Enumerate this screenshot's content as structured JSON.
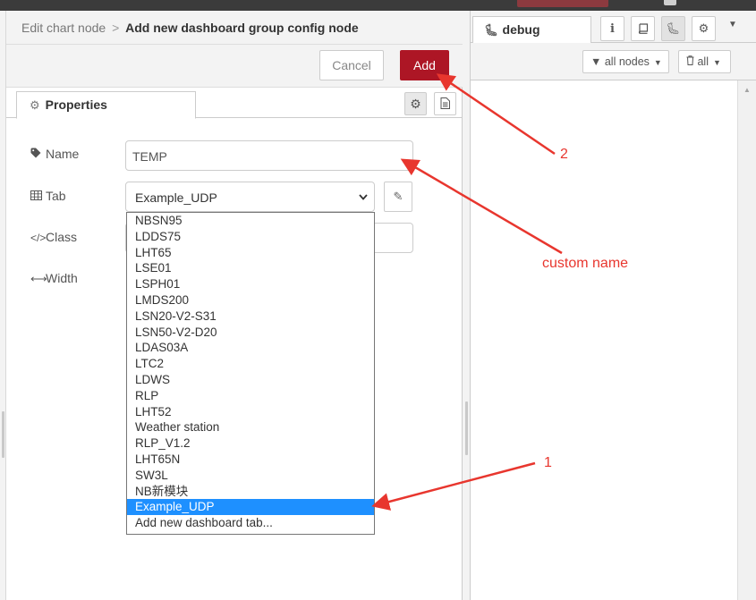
{
  "breadcrumb": {
    "prev": "Edit chart node",
    "separator": ">",
    "current": "Add new dashboard group config node"
  },
  "toolbar": {
    "cancel_label": "Cancel",
    "add_label": "Add"
  },
  "tabs": {
    "properties_label": "Properties"
  },
  "form": {
    "name_label": "Name",
    "name_value": "TEMP",
    "tab_label": "Tab",
    "tab_selected": "Example_UDP",
    "class_label": "Class",
    "width_label": "Width"
  },
  "dropdown": {
    "options": [
      "NBSN95",
      "LDDS75",
      "LHT65",
      "LSE01",
      "LSPH01",
      "LMDS200",
      "LSN20-V2-S31",
      "LSN50-V2-D20",
      "LDAS03A",
      "LTC2",
      "LDWS",
      "RLP",
      "LHT52",
      "Weather station",
      "RLP_V1.2",
      "LHT65N",
      "SW3L",
      "NB新模块",
      "Example_UDP",
      "Add new dashboard tab..."
    ],
    "selected_index": 18
  },
  "sidebar": {
    "debug_tab_label": "debug",
    "filter_nodes_label": "all nodes",
    "filter_all_label": "all"
  },
  "annotations": {
    "label_1": "1",
    "label_2": "2",
    "custom_name": "custom name"
  },
  "colors": {
    "accent_red": "#ad1625",
    "selected_blue": "#1e90ff",
    "annotation_red": "#e8362e"
  },
  "icons": {
    "properties": "gear-icon",
    "description": "document-icon",
    "name": "tag-icon",
    "tab": "table-icon",
    "class": "code-icon",
    "width": "arrows-horizontal-icon",
    "edit": "pencil-icon",
    "debug": "bug-icon",
    "info": "info-icon",
    "help": "book-icon",
    "config": "gear-icon",
    "filter": "filter-icon",
    "trash": "trash-icon"
  }
}
